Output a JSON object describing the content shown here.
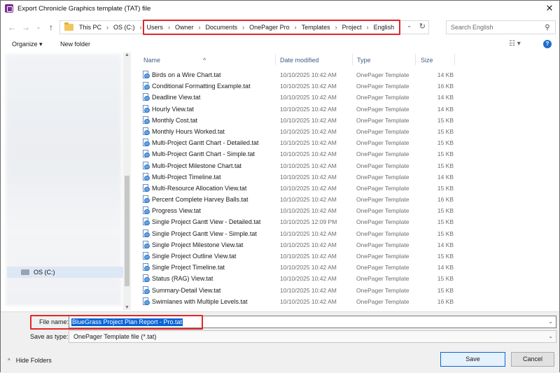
{
  "window": {
    "title": "Export Chronicle Graphics template (TAT) file",
    "close": "✕"
  },
  "nav": {
    "back": "←",
    "forward": "→",
    "up": "↑",
    "dropdown": "⌄",
    "recent": "⌄",
    "refresh": "↻"
  },
  "address": {
    "crumbs": [
      "This PC",
      "OS (C:)",
      "Users",
      "Owner",
      "Documents",
      "OnePager Pro",
      "Templates",
      "Project",
      "English"
    ],
    "separator": "›"
  },
  "search": {
    "placeholder": "Search English",
    "icon": "search-icon"
  },
  "toolbar": {
    "organize": "Organize ▾",
    "new_folder": "New folder",
    "help": "?",
    "view": "☷ ▾"
  },
  "columns": {
    "name": "Name",
    "date": "Date modified",
    "type": "Type",
    "size": "Size",
    "sort_indicator": "^"
  },
  "files": [
    {
      "name": "Birds on a Wire Chart.tat",
      "date": "10/10/2025 10:42 AM",
      "type": "OnePager Template",
      "size": "14 KB"
    },
    {
      "name": "Conditional Formatting Example.tat",
      "date": "10/10/2025 10:42 AM",
      "type": "OnePager Template",
      "size": "16 KB"
    },
    {
      "name": "Deadline View.tat",
      "date": "10/10/2025 10:42 AM",
      "type": "OnePager Template",
      "size": "14 KB"
    },
    {
      "name": "Hourly View.tat",
      "date": "10/10/2025 10:42 AM",
      "type": "OnePager Template",
      "size": "14 KB"
    },
    {
      "name": "Monthly Cost.tat",
      "date": "10/10/2025 10:42 AM",
      "type": "OnePager Template",
      "size": "15 KB"
    },
    {
      "name": "Monthly Hours Worked.tat",
      "date": "10/10/2025 10:42 AM",
      "type": "OnePager Template",
      "size": "15 KB"
    },
    {
      "name": "Multi-Project Gantt Chart - Detailed.tat",
      "date": "10/10/2025 10:42 AM",
      "type": "OnePager Template",
      "size": "15 KB"
    },
    {
      "name": "Multi-Project Gantt Chart - Simple.tat",
      "date": "10/10/2025 10:42 AM",
      "type": "OnePager Template",
      "size": "15 KB"
    },
    {
      "name": "Multi-Project Milestone Chart.tat",
      "date": "10/10/2025 10:42 AM",
      "type": "OnePager Template",
      "size": "15 KB"
    },
    {
      "name": "Multi-Project Timeline.tat",
      "date": "10/10/2025 10:42 AM",
      "type": "OnePager Template",
      "size": "14 KB"
    },
    {
      "name": "Multi-Resource Allocation View.tat",
      "date": "10/10/2025 10:42 AM",
      "type": "OnePager Template",
      "size": "15 KB"
    },
    {
      "name": "Percent Complete Harvey Balls.tat",
      "date": "10/10/2025 10:42 AM",
      "type": "OnePager Template",
      "size": "16 KB"
    },
    {
      "name": "Progress View.tat",
      "date": "10/10/2025 10:42 AM",
      "type": "OnePager Template",
      "size": "15 KB"
    },
    {
      "name": "Single Project Gantt View - Detailed.tat",
      "date": "10/10/2025 12:09 PM",
      "type": "OnePager Template",
      "size": "15 KB"
    },
    {
      "name": "Single Project Gantt View - Simple.tat",
      "date": "10/10/2025 10:42 AM",
      "type": "OnePager Template",
      "size": "15 KB"
    },
    {
      "name": "Single Project Milestone View.tat",
      "date": "10/10/2025 10:42 AM",
      "type": "OnePager Template",
      "size": "14 KB"
    },
    {
      "name": "Single Project Outline View.tat",
      "date": "10/10/2025 10:42 AM",
      "type": "OnePager Template",
      "size": "15 KB"
    },
    {
      "name": "Single Project Timeline.tat",
      "date": "10/10/2025 10:42 AM",
      "type": "OnePager Template",
      "size": "14 KB"
    },
    {
      "name": "Status (RAG) View.tat",
      "date": "10/10/2025 10:42 AM",
      "type": "OnePager Template",
      "size": "15 KB"
    },
    {
      "name": "Summary-Detail View.tat",
      "date": "10/10/2025 10:42 AM",
      "type": "OnePager Template",
      "size": "15 KB"
    },
    {
      "name": "Swimlanes with Multiple Levels.tat",
      "date": "10/10/2025 10:42 AM",
      "type": "OnePager Template",
      "size": "16 KB"
    }
  ],
  "navpane": {
    "selected_drive": "OS (C:)"
  },
  "form": {
    "file_name_label": "File name:",
    "file_name_value": "BlueGrass Project Plan Report - Pro.tat",
    "save_as_type_label": "Save as type:",
    "save_as_type_value": "OnePager Template file (*.tat)",
    "dropdown": "⌄"
  },
  "footer": {
    "hide_folders": "Hide Folders",
    "caret": "^",
    "save": "Save",
    "cancel": "Cancel"
  },
  "colors": {
    "highlight_red": "#e0262c",
    "selection_blue": "#0a64d6",
    "header_text": "#3f5f8a"
  }
}
